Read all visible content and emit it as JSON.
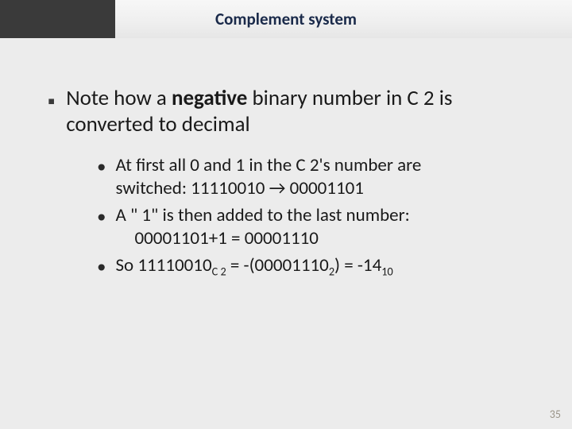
{
  "title": "Complement system",
  "main_bullet": {
    "marker": "▪",
    "pre": "Note how a ",
    "bold": "negative",
    "post": " binary number in C 2 is converted to decimal"
  },
  "sub": [
    {
      "dot": "•",
      "line1": "At first all 0 and 1 in the C 2's number are",
      "line2": "switched: 11110010 → 00001101"
    },
    {
      "dot": "•",
      "line1": "A \" 1\" is then added to the last number:",
      "line2": "00001101+1 = 00001110"
    },
    {
      "dot": "•",
      "pre": "So 11110010",
      "sub1": "C 2",
      "mid": " = -(00001110",
      "sub2": "2",
      "mid2": ") = -14",
      "sub3": "10"
    }
  ],
  "page_number": "35"
}
